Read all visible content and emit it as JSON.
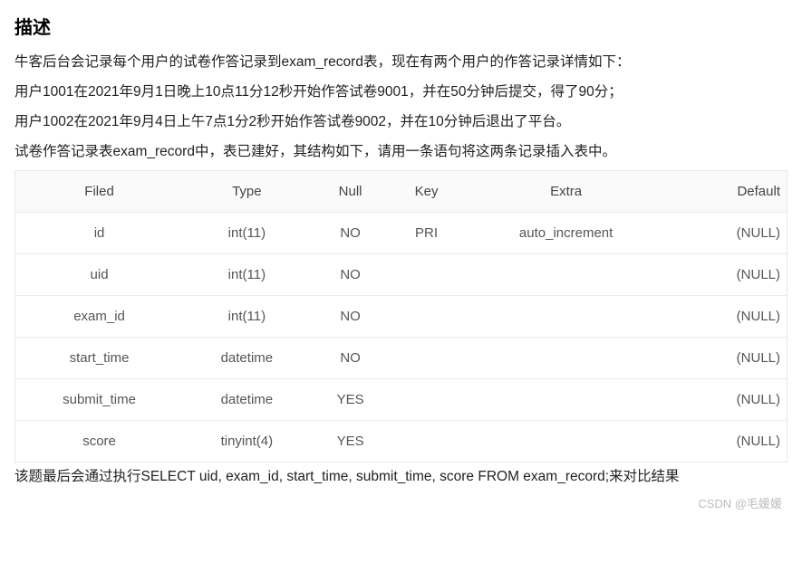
{
  "title": "描述",
  "desc_line1": "牛客后台会记录每个用户的试卷作答记录到exam_record表，现在有两个用户的作答记录详情如下：",
  "desc_line2": "用户1001在2021年9月1日晚上10点11分12秒开始作答试卷9001，并在50分钟后提交，得了90分；",
  "desc_line3": "用户1002在2021年9月4日上午7点1分2秒开始作答试卷9002，并在10分钟后退出了平台。",
  "desc_line4": "试卷作答记录表exam_record中，表已建好，其结构如下，请用一条语句将这两条记录插入表中。",
  "table": {
    "headers": [
      "Filed",
      "Type",
      "Null",
      "Key",
      "Extra",
      "Default"
    ],
    "rows": [
      {
        "filed": "id",
        "type": "int(11)",
        "null": "NO",
        "key": "PRI",
        "extra": "auto_increment",
        "default": "(NULL)"
      },
      {
        "filed": "uid",
        "type": "int(11)",
        "null": "NO",
        "key": "",
        "extra": "",
        "default": "(NULL)"
      },
      {
        "filed": "exam_id",
        "type": "int(11)",
        "null": "NO",
        "key": "",
        "extra": "",
        "default": "(NULL)"
      },
      {
        "filed": "start_time",
        "type": "datetime",
        "null": "NO",
        "key": "",
        "extra": "",
        "default": "(NULL)"
      },
      {
        "filed": "submit_time",
        "type": "datetime",
        "null": "YES",
        "key": "",
        "extra": "",
        "default": "(NULL)"
      },
      {
        "filed": "score",
        "type": "tinyint(4)",
        "null": "YES",
        "key": "",
        "extra": "",
        "default": "(NULL)"
      }
    ]
  },
  "footnote": "该题最后会通过执行SELECT uid, exam_id, start_time, submit_time, score FROM exam_record;来对比结果",
  "watermark": "CSDN @毛媛媛"
}
